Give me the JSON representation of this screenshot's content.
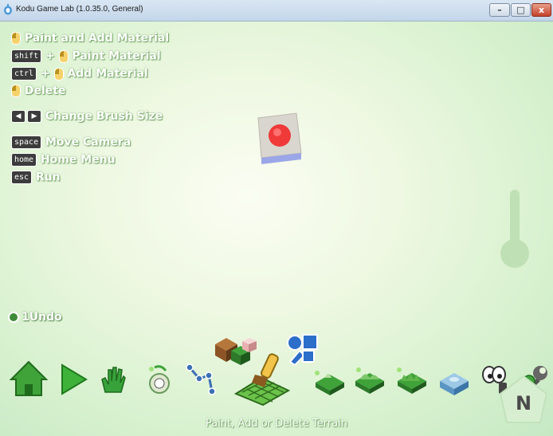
{
  "window": {
    "title": "Kodu Game Lab (1.0.35.0, General)",
    "minimize_glyph": "–",
    "maximize_glyph": "□",
    "close_glyph": "x"
  },
  "help": {
    "paint_add": "Paint and Add Material",
    "shift_key": "shift",
    "paint_material": "Paint Material",
    "ctrl_key": "ctrl",
    "add_material": "Add Material",
    "delete": "Delete",
    "change_brush": "Change Brush Size",
    "space_key": "space",
    "move_camera": "Move Camera",
    "home_key": "home",
    "home_menu": "Home Menu",
    "esc_key": "esc",
    "run": "Run",
    "plus": "+"
  },
  "undo": {
    "label": "1Undo"
  },
  "toolbar": {
    "items": [
      "home-menu",
      "play",
      "object-tool",
      "path-tool",
      "terrain-paint",
      "terrain-raise",
      "terrain-smooth",
      "terrain-roughen",
      "water",
      "erase",
      "world-settings",
      "settings-tool"
    ]
  },
  "status": {
    "label": "Paint, Add or Delete Terrain"
  },
  "compass": {
    "label": "N"
  },
  "colors": {
    "background": "#e8f6dc",
    "accent_green": "#3f9a3a",
    "title_bar": "#c3d6ea"
  }
}
